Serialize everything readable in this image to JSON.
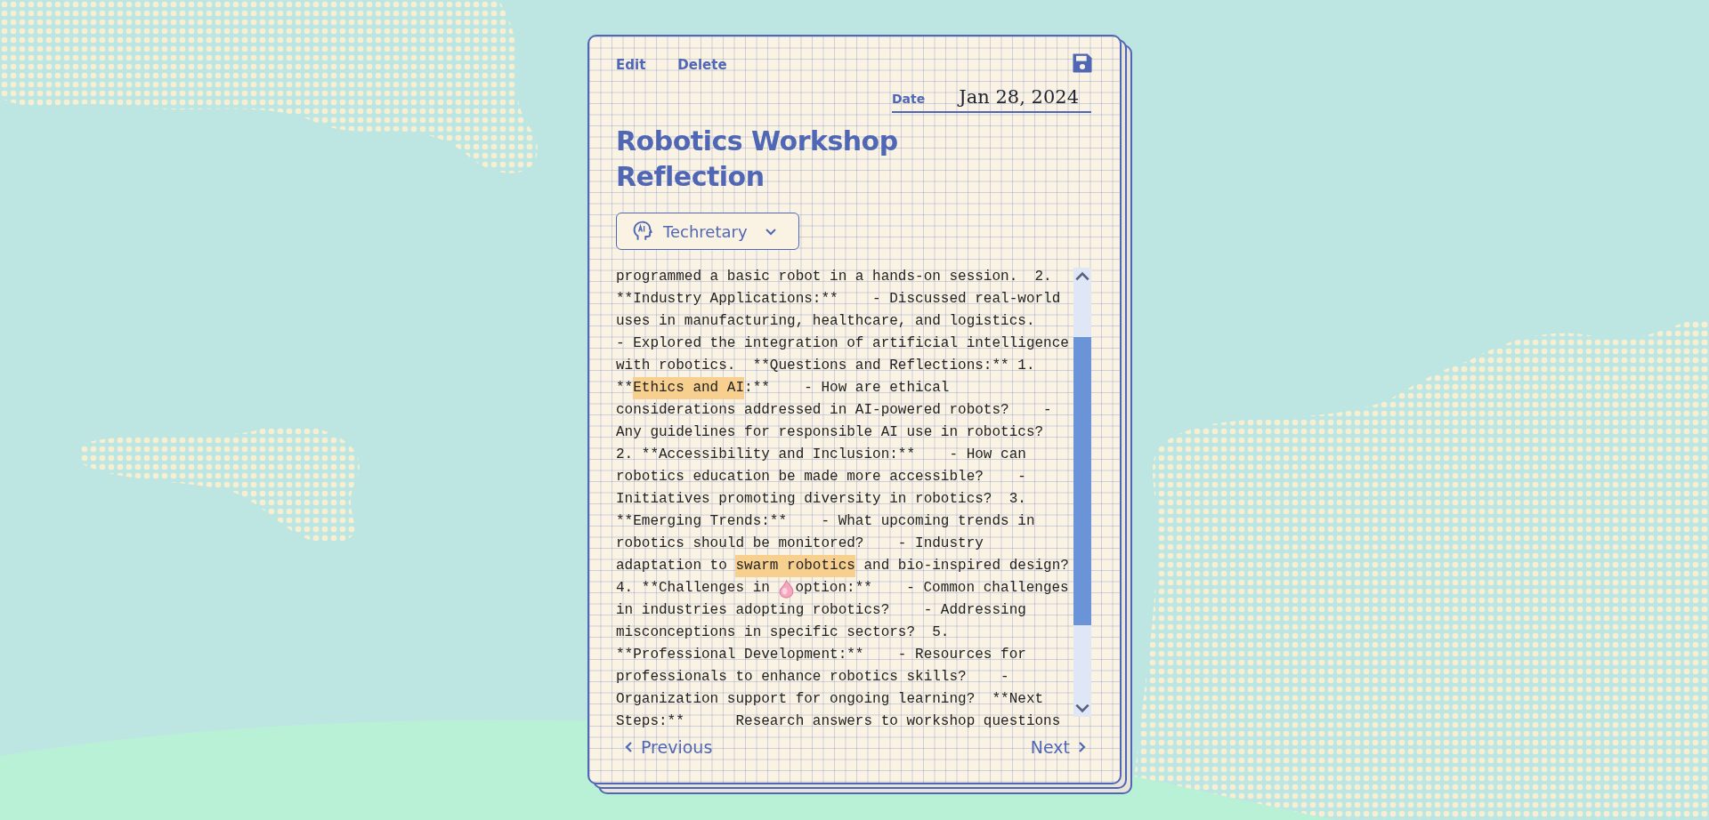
{
  "toolbar": {
    "actions": [
      "Edit",
      "Delete"
    ]
  },
  "date": {
    "label": "Date",
    "value": "Jan 28, 2024"
  },
  "title": "Robotics Workshop Reflection",
  "assistant_dropdown": {
    "value": "Techretary"
  },
  "notes": {
    "lines": [
      [
        {
          "kind": "text",
          "text": "programmed a basic robot in a hands-on session.  2."
        }
      ],
      [
        {
          "kind": "text",
          "text": "**Industry Applications:**    - Discussed real-world"
        }
      ],
      [
        {
          "kind": "text",
          "text": "uses in manufacturing, healthcare, and logistics."
        }
      ],
      [
        {
          "kind": "text",
          "text": "- Explored the integration of artificial intelligence"
        }
      ],
      [
        {
          "kind": "text",
          "text": "with robotics.  **Questions and Reflections:** 1."
        }
      ],
      [
        {
          "kind": "text",
          "text": "**"
        },
        {
          "kind": "highlight",
          "text": "Ethics and AI"
        },
        {
          "kind": "text",
          "text": ":**    - How are ethical"
        }
      ],
      [
        {
          "kind": "text",
          "text": "considerations addressed in AI-powered robots?    -"
        }
      ],
      [
        {
          "kind": "text",
          "text": "Any guidelines for responsible AI use in robotics?"
        }
      ],
      [
        {
          "kind": "text",
          "text": "2. **Accessibility and Inclusion:**    - How can"
        }
      ],
      [
        {
          "kind": "text",
          "text": "robotics education be made more accessible?    -"
        }
      ],
      [
        {
          "kind": "text",
          "text": "Initiatives promoting diversity in robotics?  3."
        }
      ],
      [
        {
          "kind": "text",
          "text": "**Emerging Trends:**    - What upcoming trends in"
        }
      ],
      [
        {
          "kind": "text",
          "text": "robotics should be monitored?    - Industry"
        }
      ],
      [
        {
          "kind": "text",
          "text": "adaptation to "
        },
        {
          "kind": "highlight",
          "text": "swarm robotics"
        },
        {
          "kind": "text",
          "text": " and bio-inspired design?"
        }
      ],
      [
        {
          "kind": "text",
          "text": "4. **Challenges in "
        },
        {
          "kind": "cursor"
        },
        {
          "kind": "text",
          "text": "option:**    - Common challenges"
        }
      ],
      [
        {
          "kind": "text",
          "text": "in industries adopting robotics?    - Addressing"
        }
      ],
      [
        {
          "kind": "text",
          "text": "misconceptions in specific sectors?  5."
        }
      ],
      [
        {
          "kind": "text",
          "text": "**Professional Development:**    - Resources for"
        }
      ],
      [
        {
          "kind": "text",
          "text": "professionals to enhance robotics skills?    -"
        }
      ],
      [
        {
          "kind": "text",
          "text": "Organization support for ongoing learning?  **Next"
        }
      ],
      [
        {
          "kind": "text",
          "text": "Steps:**      Research answers to workshop questions"
        }
      ]
    ]
  },
  "pagination": {
    "previous": "Previous",
    "next": "Next"
  }
}
